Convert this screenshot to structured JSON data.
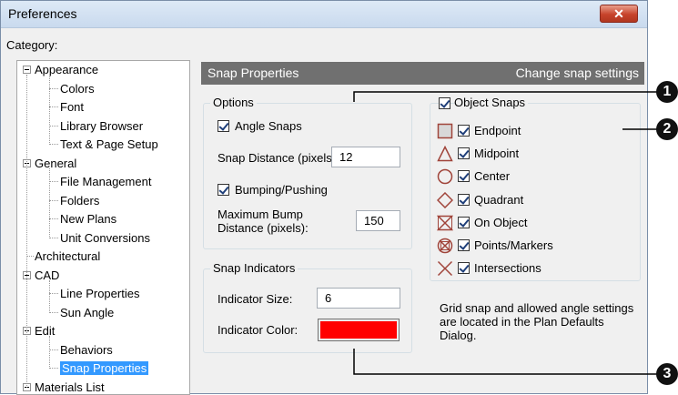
{
  "window": {
    "title": "Preferences",
    "close_glyph": "✕"
  },
  "category_label": "Category:",
  "tree": [
    {
      "label": "Appearance",
      "level": 0,
      "expander": true,
      "selected": false
    },
    {
      "label": "Colors",
      "level": 1,
      "selected": false
    },
    {
      "label": "Font",
      "level": 1,
      "selected": false
    },
    {
      "label": "Library Browser",
      "level": 1,
      "selected": false
    },
    {
      "label": "Text & Page Setup",
      "level": 1,
      "selected": false
    },
    {
      "label": "General",
      "level": 0,
      "expander": true,
      "selected": false
    },
    {
      "label": "File Management",
      "level": 1,
      "selected": false
    },
    {
      "label": "Folders",
      "level": 1,
      "selected": false
    },
    {
      "label": "New Plans",
      "level": 1,
      "selected": false
    },
    {
      "label": "Unit Conversions",
      "level": 1,
      "selected": false
    },
    {
      "label": "Architectural",
      "level": 0,
      "expander": false,
      "selected": false
    },
    {
      "label": "CAD",
      "level": 0,
      "expander": true,
      "selected": false
    },
    {
      "label": "Line Properties",
      "level": 1,
      "selected": false
    },
    {
      "label": "Sun Angle",
      "level": 1,
      "selected": false
    },
    {
      "label": "Edit",
      "level": 0,
      "expander": true,
      "selected": false
    },
    {
      "label": "Behaviors",
      "level": 1,
      "selected": false
    },
    {
      "label": "Snap Properties",
      "level": 1,
      "selected": true
    },
    {
      "label": "Materials List",
      "level": 0,
      "expander": true,
      "selected": false
    }
  ],
  "header": {
    "title": "Snap Properties",
    "subtitle": "Change snap settings"
  },
  "options": {
    "group_label": "Options",
    "angle_snaps": {
      "label": "Angle Snaps",
      "checked": true
    },
    "snap_distance": {
      "label": "Snap Distance (pixels):",
      "value": "12"
    },
    "bumping": {
      "label": "Bumping/Pushing",
      "checked": true
    },
    "max_bump": {
      "label_line1": "Maximum Bump",
      "label_line2": "Distance (pixels):",
      "value": "150"
    }
  },
  "snap_indicators": {
    "group_label": "Snap Indicators",
    "size": {
      "label": "Indicator Size:",
      "value": "6"
    },
    "color": {
      "label": "Indicator Color:",
      "value_hex": "#ff0000"
    }
  },
  "object_snaps": {
    "group_label": "Object Snaps",
    "checked": true,
    "items": [
      {
        "label": "Endpoint",
        "icon": "endpoint-square-icon",
        "checked": true
      },
      {
        "label": "Midpoint",
        "icon": "midpoint-triangle-icon",
        "checked": true
      },
      {
        "label": "Center",
        "icon": "center-circle-icon",
        "checked": true
      },
      {
        "label": "Quadrant",
        "icon": "quadrant-diamond-icon",
        "checked": true
      },
      {
        "label": "On Object",
        "icon": "on-object-hourglass-icon",
        "checked": true
      },
      {
        "label": "Points/Markers",
        "icon": "points-markers-icon",
        "checked": true
      },
      {
        "label": "Intersections",
        "icon": "intersections-x-icon",
        "checked": true
      }
    ]
  },
  "note": "Grid snap and allowed angle settings are located in the Plan Defaults Dialog.",
  "callouts": [
    "1",
    "2",
    "3"
  ],
  "colors": {
    "header_bar": "#707070",
    "selection": "#3399ff",
    "snap_icon_stroke": "#a0443a",
    "indicator": "#ff0000"
  }
}
